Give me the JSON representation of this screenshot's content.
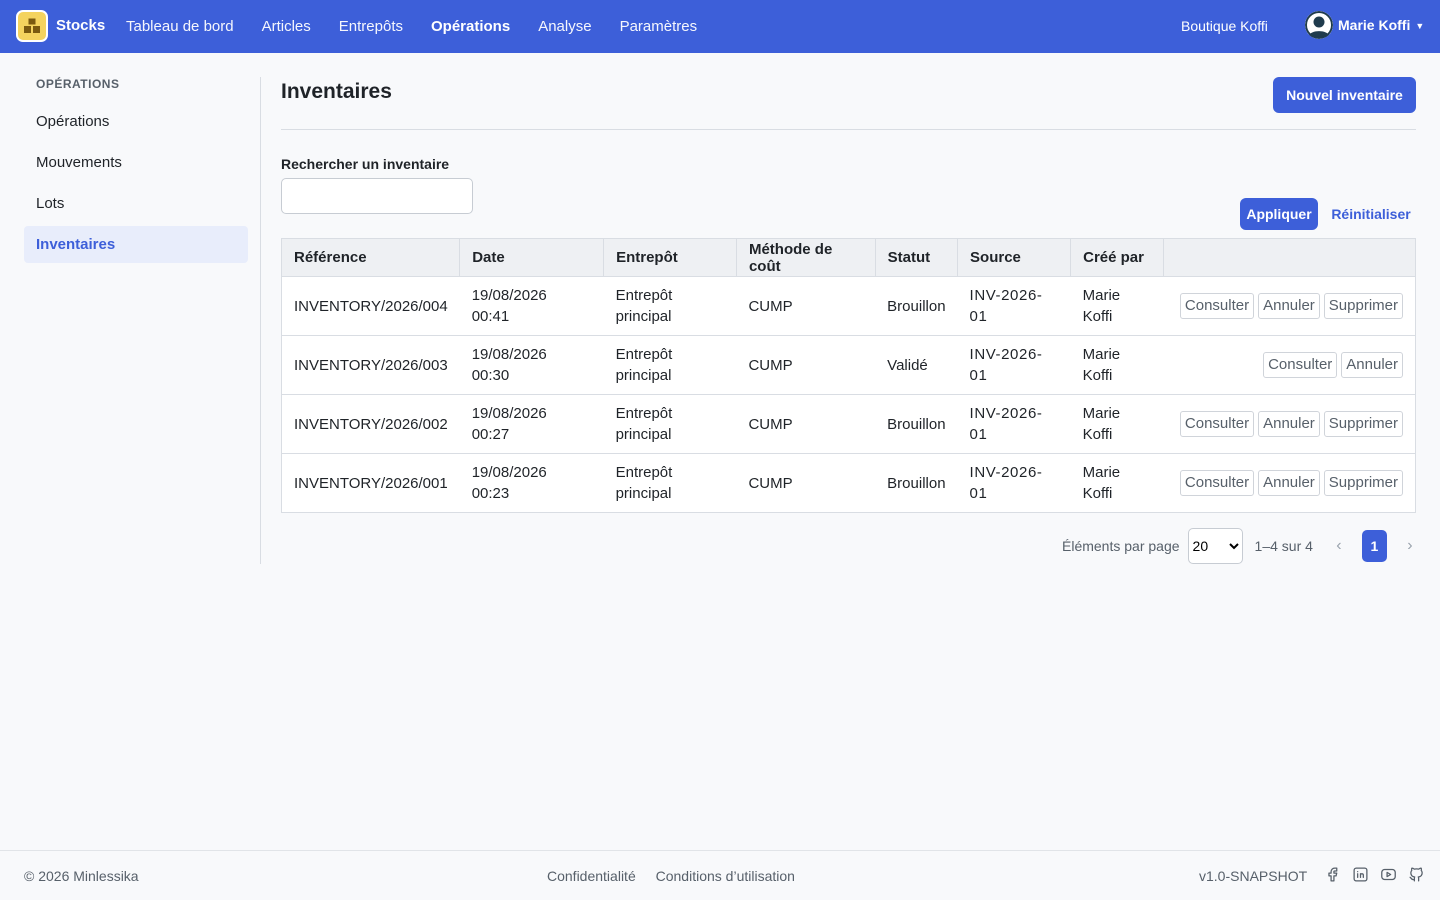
{
  "header": {
    "brand": "Stocks",
    "nav": [
      "Tableau de bord",
      "Articles",
      "Entrepôts",
      "Opérations",
      "Analyse",
      "Paramètres"
    ],
    "active_nav": "Opérations",
    "shop": "Boutique Koffi",
    "user_name": "Marie Koffi",
    "accent_color": "#3d5fd9"
  },
  "sidebar": {
    "heading": "OPÉRATIONS",
    "items": [
      "Opérations",
      "Mouvements",
      "Lots",
      "Inventaires"
    ],
    "active": "Inventaires"
  },
  "main": {
    "title": "Inventaires",
    "new_button": "Nouvel inventaire",
    "search_label": "Rechercher un inventaire",
    "search_value": "",
    "apply_button": "Appliquer",
    "reset_button": "Réinitialiser"
  },
  "table": {
    "columns": [
      "Référence",
      "Date",
      "Entrepôt",
      "Méthode de coût",
      "Statut",
      "Source",
      "Créé par",
      ""
    ],
    "rows": [
      {
        "ref": "INVENTORY/2026/004",
        "date": "19/08/2026",
        "time": "00:41",
        "wh1": "Entrepôt",
        "wh2": "principal",
        "method": "CUMP",
        "status": "Brouillon",
        "src1": "INV-2026-",
        "src2": "01",
        "by1": "Marie",
        "by2": "Koffi",
        "actions": [
          "Consulter",
          "Annuler",
          "Supprimer"
        ]
      },
      {
        "ref": "INVENTORY/2026/003",
        "date": "19/08/2026",
        "time": "00:30",
        "wh1": "Entrepôt",
        "wh2": "principal",
        "method": "CUMP",
        "status": "Validé",
        "src1": "INV-2026-",
        "src2": "01",
        "by1": "Marie",
        "by2": "Koffi",
        "actions": [
          "Consulter",
          "Annuler"
        ]
      },
      {
        "ref": "INVENTORY/2026/002",
        "date": "19/08/2026",
        "time": "00:27",
        "wh1": "Entrepôt",
        "wh2": "principal",
        "method": "CUMP",
        "status": "Brouillon",
        "src1": "INV-2026-",
        "src2": "01",
        "by1": "Marie",
        "by2": "Koffi",
        "actions": [
          "Consulter",
          "Annuler",
          "Supprimer"
        ]
      },
      {
        "ref": "INVENTORY/2026/001",
        "date": "19/08/2026",
        "time": "00:23",
        "wh1": "Entrepôt",
        "wh2": "principal",
        "method": "CUMP",
        "status": "Brouillon",
        "src1": "INV-2026-",
        "src2": "01",
        "by1": "Marie",
        "by2": "Koffi",
        "actions": [
          "Consulter",
          "Annuler",
          "Supprimer"
        ]
      }
    ]
  },
  "pagination": {
    "per_page_label": "Éléments par page",
    "per_page_value": "20",
    "range": "1–4 sur 4",
    "current_page": "1",
    "prev": "‹",
    "next": "›"
  },
  "footer": {
    "copyright": "© 2026 Minlessika",
    "links": [
      "Confidentialité",
      "Conditions d’utilisation"
    ],
    "version": "v1.0-SNAPSHOT",
    "social_icons": [
      "facebook-icon",
      "linkedin-icon",
      "youtube-icon",
      "github-icon"
    ]
  }
}
